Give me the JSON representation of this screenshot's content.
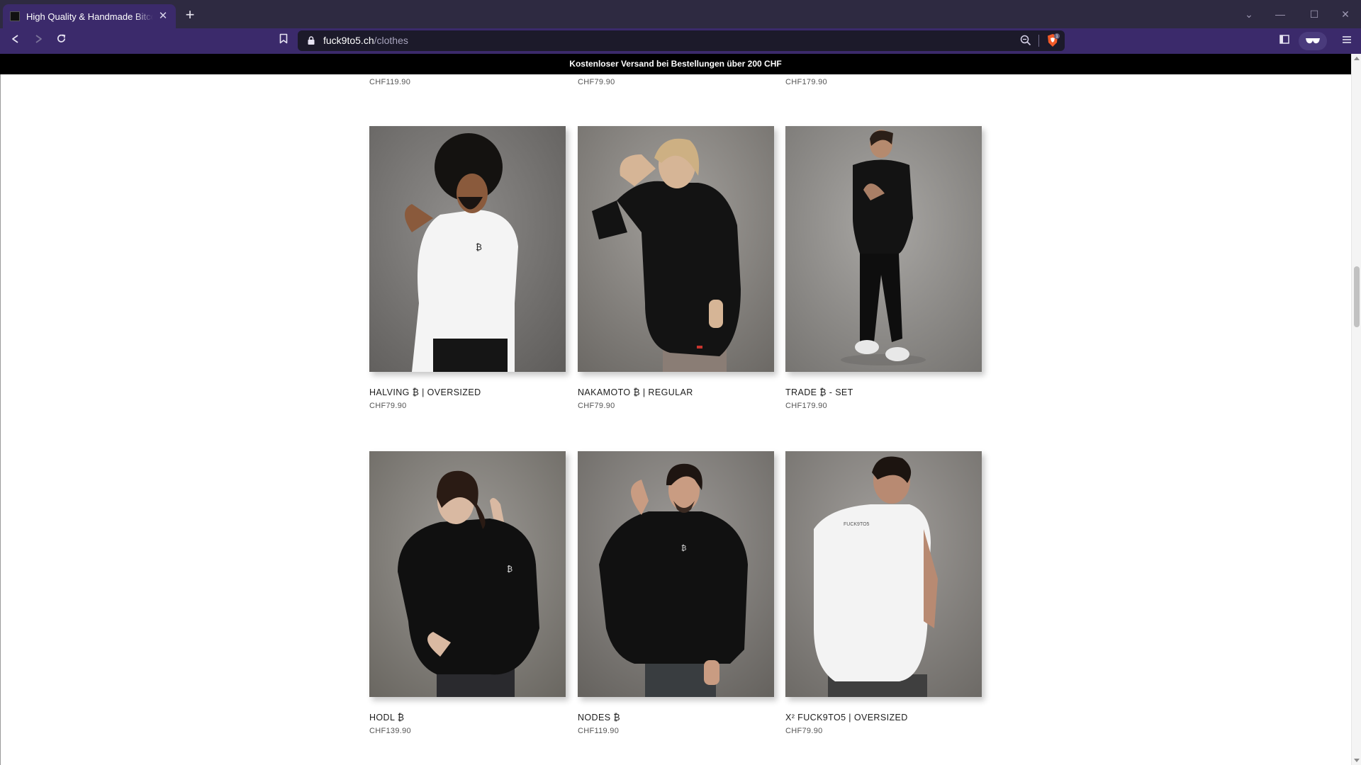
{
  "browser": {
    "tab_title": "High Quality & Handmade Bitcoin Clothing",
    "url_host": "fuck9to5.ch",
    "url_path": "/clothes",
    "shield_badge": "1"
  },
  "promo_banner": "Kostenloser Versand bei Bestellungen über 200 CHF",
  "previous_row_prices": [
    "CHF119.90",
    "CHF79.90",
    "CHF179.90"
  ],
  "products": [
    {
      "name": "HALVING ₿ | OVERSIZED",
      "price": "CHF79.90"
    },
    {
      "name": "NAKAMOTO ₿ | REGULAR",
      "price": "CHF79.90"
    },
    {
      "name": "TRADE ₿ - SET",
      "price": "CHF179.90"
    },
    {
      "name": "HODL ₿",
      "price": "CHF139.90"
    },
    {
      "name": "NODES ₿",
      "price": "CHF119.90"
    },
    {
      "name": "X² FUCK9TO5 | OVERSIZED",
      "price": "CHF79.90"
    }
  ],
  "icons": {
    "back": "arrow-left-icon",
    "forward": "arrow-right-icon",
    "reload": "reload-icon",
    "bookmark": "bookmark-icon",
    "lock": "lock-icon",
    "zoom": "zoom-icon",
    "shield": "brave-shield-icon",
    "sidebar": "sidebar-icon",
    "vpn": "glasses-icon",
    "menu": "menu-icon"
  },
  "colors": {
    "tabbar": "#2e2a41",
    "toolbar": "#3b2a6b",
    "promo_bar": "#000000"
  }
}
